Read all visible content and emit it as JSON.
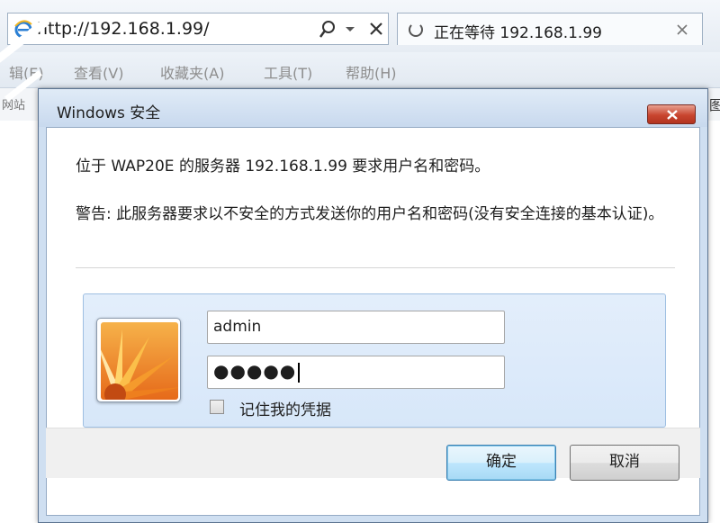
{
  "browser": {
    "url": "http://192.168.1.99/",
    "tab_title": "正在等待 192.168.1.99",
    "menu": [
      "辑(E)",
      "查看(V)",
      "收藏夹(A)",
      "工具(T)",
      "帮助(H)"
    ],
    "favbar_left": "网站",
    "favbar_right": "图"
  },
  "dialog": {
    "title": "Windows 安全",
    "message": "位于 WAP20E 的服务器 192.168.1.99 要求用户名和密码。",
    "warning": "警告: 此服务器要求以不安全的方式发送你的用户名和密码(没有安全连接的基本认证)。",
    "username": "admin",
    "password_mask": "●●●●●",
    "remember_label": "记住我的凭据",
    "remember_checked": false,
    "ok_label": "确定",
    "cancel_label": "取消"
  },
  "icons": {
    "browser": "ie-icon",
    "search": "search-icon",
    "close": "close-icon",
    "avatar": "flower-avatar"
  },
  "colors": {
    "close_button": "#c8452f",
    "ok_button_border": "#3c7fb1",
    "dialog_frame": "#cfdff1"
  }
}
